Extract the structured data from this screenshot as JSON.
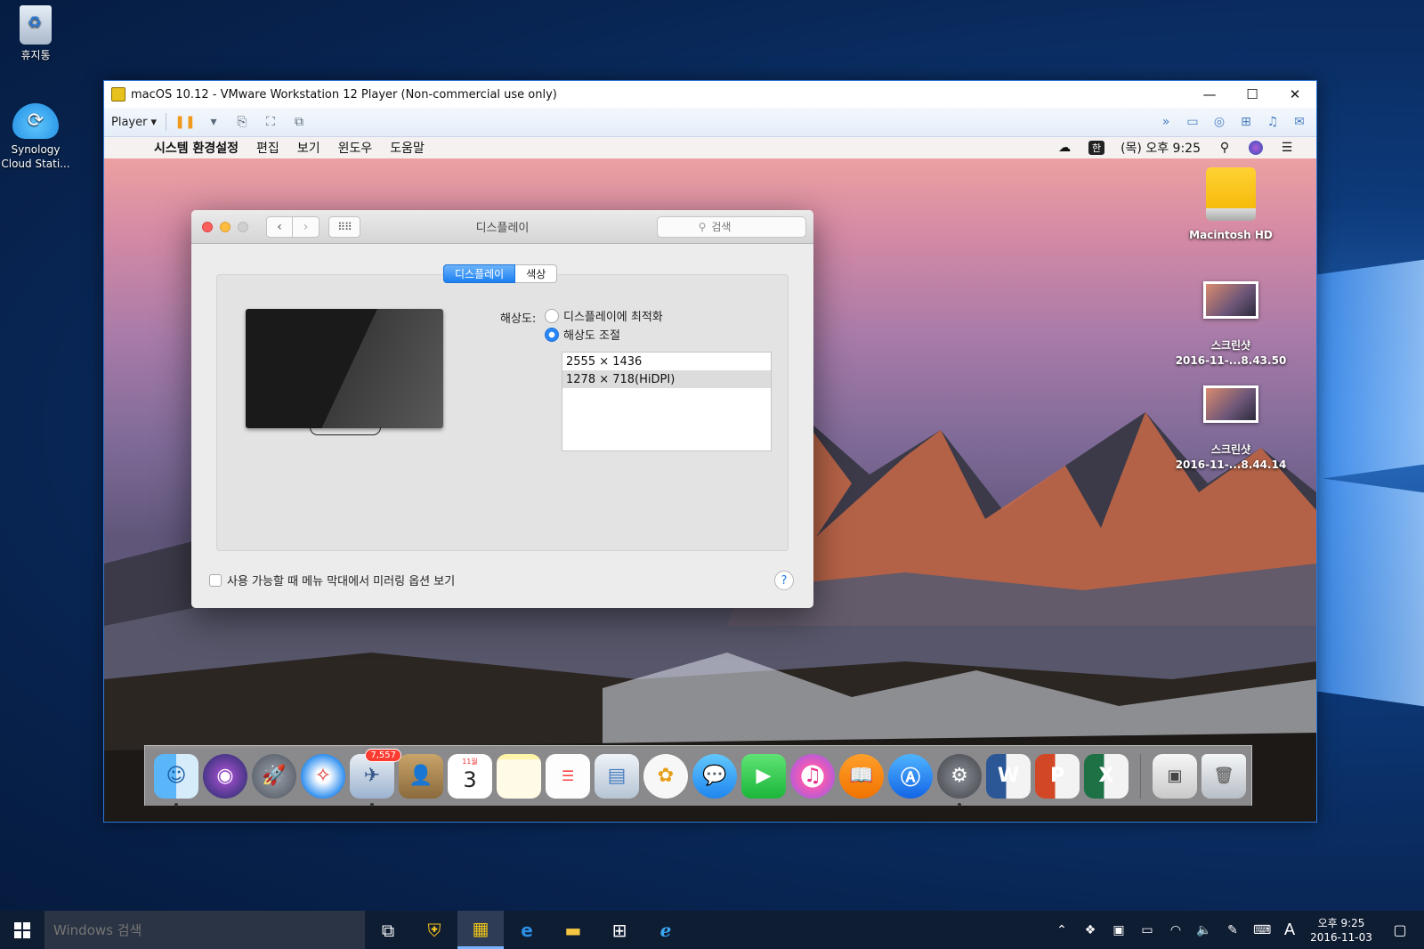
{
  "windows_desktop": {
    "icons": [
      {
        "label": "휴지통"
      },
      {
        "label": "Synology Cloud Stati..."
      }
    ]
  },
  "vmware": {
    "title": "macOS 10.12 - VMware Workstation 12 Player (Non-commercial use only)",
    "player_menu": "Player",
    "controls": {
      "minimize": "—",
      "maximize": "☐",
      "close": "✕"
    }
  },
  "mac_menubar": {
    "app_name": "시스템 환경설정",
    "menus": [
      "편집",
      "보기",
      "윈도우",
      "도움말"
    ],
    "input_method": "한",
    "clock": "(목) 오후 9:25"
  },
  "mac_desktop": {
    "icons": [
      {
        "label": "Macintosh HD"
      },
      {
        "label": "스크린샷",
        "sublabel": "2016-11-...8.43.50"
      },
      {
        "label": "스크린샷",
        "sublabel": "2016-11-...8.44.14"
      }
    ]
  },
  "prefs": {
    "title": "디스플레이",
    "search_placeholder": "검색",
    "tabs": [
      {
        "label": "디스플레이",
        "active": true
      },
      {
        "label": "색상",
        "active": false
      }
    ],
    "resolution_label": "해상도:",
    "options": [
      {
        "label": "디스플레이에 최적화",
        "selected": false
      },
      {
        "label": "해상도 조절",
        "selected": true
      }
    ],
    "resolutions": [
      {
        "label": "2555 × 1436",
        "selected": false
      },
      {
        "label": "1278 × 718(HiDPI)",
        "selected": true
      }
    ],
    "mirror_option": "사용 가능할 때 메뉴 막대에서 미러링 옵션 보기",
    "help": "?"
  },
  "dock": {
    "mail_badge": "7,557",
    "calendar_month": "11월",
    "calendar_day": "3"
  },
  "taskbar": {
    "search_placeholder": "Windows 검색",
    "ime": "A",
    "time": "오후 9:25",
    "date": "2016-11-03"
  }
}
